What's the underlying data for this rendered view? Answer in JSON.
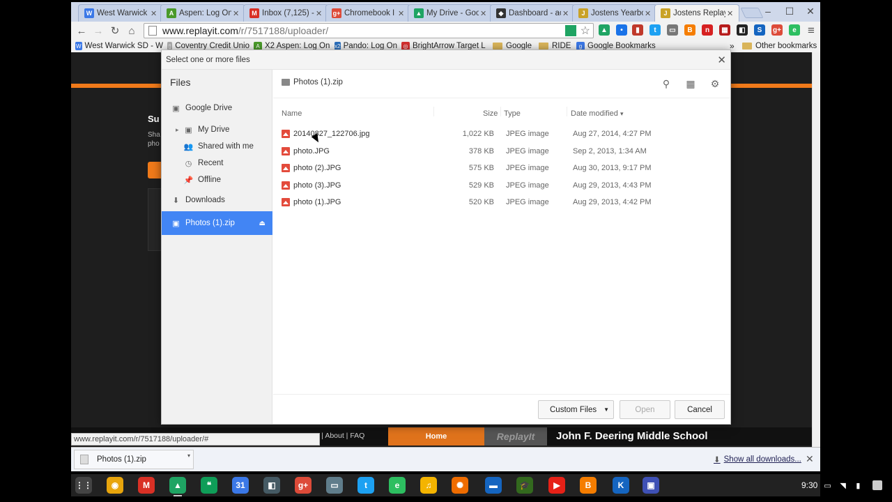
{
  "window": {
    "minimize": "–",
    "maximize": "☐",
    "close": "✕"
  },
  "tabs": [
    {
      "title": "West Warwick I",
      "favicon": "W",
      "color": "#3b78e7"
    },
    {
      "title": "Aspen: Log On",
      "favicon": "A",
      "color": "#4a9a2a"
    },
    {
      "title": "Inbox (7,125) - ",
      "favicon": "M",
      "color": "#d93025"
    },
    {
      "title": "Chromebook I",
      "favicon": "g+",
      "color": "#dd4b39"
    },
    {
      "title": "My Drive - Goo",
      "favicon": "▲",
      "color": "#1fa463"
    },
    {
      "title": "Dashboard - ac",
      "favicon": "◆",
      "color": "#333333"
    },
    {
      "title": "Jostens Yearbo",
      "favicon": "J",
      "color": "#c9a227"
    },
    {
      "title": "Jostens ReplayI",
      "favicon": "J",
      "color": "#c9a227"
    }
  ],
  "toolbar": {
    "back": "←",
    "forward": "→",
    "reload": "↻",
    "home": "⌂",
    "url_host": "www.replayit.com",
    "url_path": "/r/7517188/uploader/",
    "star": "☆",
    "menu": "≡",
    "extensions": [
      {
        "name": "drive-ext-icon",
        "label": "▲",
        "color": "#1fa463"
      },
      {
        "name": "pocket-ext-icon",
        "label": "•",
        "color": "#1a73e8"
      },
      {
        "name": "book-ext-icon",
        "label": "▮",
        "color": "#c0392b"
      },
      {
        "name": "twitter-ext-icon",
        "label": "t",
        "color": "#1da1f2"
      },
      {
        "name": "cast-ext-icon",
        "label": "▭",
        "color": "#777777"
      },
      {
        "name": "blogger-ext-icon",
        "label": "B",
        "color": "#f57d00"
      },
      {
        "name": "npr-ext-icon",
        "label": "n",
        "color": "#d62021"
      },
      {
        "name": "film-ext-icon",
        "label": "▦",
        "color": "#b71c1c"
      },
      {
        "name": "screencast-ext-icon",
        "label": "◧",
        "color": "#222222"
      },
      {
        "name": "s-ext-icon",
        "label": "S",
        "color": "#1565c0"
      },
      {
        "name": "gplus-ext-icon",
        "label": "g+",
        "color": "#dd4b39"
      },
      {
        "name": "evernote-ext-icon",
        "label": "e",
        "color": "#2dbe60"
      }
    ]
  },
  "bookmarks": [
    {
      "label": "West Warwick SD - W",
      "icon": "W",
      "color": "#3b78e7"
    },
    {
      "label": "Coventry Credit Unio",
      "icon": "▯",
      "color": "#aaaaaa"
    },
    {
      "label": "X2 Aspen: Log On",
      "icon": "A",
      "color": "#4a9a2a"
    },
    {
      "label": "Pando: Log On",
      "icon": "x2",
      "color": "#2a6ebb"
    },
    {
      "label": "BrightArrow Target L",
      "icon": "◎",
      "color": "#d32f2f"
    },
    {
      "label": "Google",
      "icon": "folder",
      "color": "#d9b45a"
    },
    {
      "label": "RIDE",
      "icon": "folder",
      "color": "#d9b45a"
    },
    {
      "label": "Google Bookmarks",
      "icon": "g",
      "color": "#3b78e7"
    }
  ],
  "bookmarks_more": "»",
  "other_bookmarks": "Other bookmarks",
  "page": {
    "fragment_heading": "Su",
    "fragment_text1": "Sha",
    "fragment_text2": "pho",
    "footer_links": "acy  |  About  |  FAQ",
    "footer_home": "Home",
    "footer_logo": "ReplayIt",
    "footer_school": "John F. Deering Middle School",
    "status_url": "www.replayit.com/r/7517188/uploader/#"
  },
  "dialog": {
    "title": "Select one or more files",
    "close": "✕",
    "nav_header": "Files",
    "nav_items": [
      {
        "label": "Google Drive",
        "icon": "▣",
        "indent": 0
      },
      {
        "label": "My Drive",
        "icon": "▣",
        "indent": 1,
        "arrow": "▸"
      },
      {
        "label": "Shared with me",
        "icon": "👥",
        "indent": 1
      },
      {
        "label": "Recent",
        "icon": "◷",
        "indent": 1
      },
      {
        "label": "Offline",
        "icon": "📌",
        "indent": 1
      },
      {
        "label": "Downloads",
        "icon": "⬇",
        "indent": 0
      },
      {
        "label": "Photos (1).zip",
        "icon": "▣",
        "indent": 0,
        "selected": true,
        "eject": "⏏"
      }
    ],
    "breadcrumb": "Photos (1).zip",
    "search_icon": "⚲",
    "grid_icon": "▦",
    "gear_icon": "⚙",
    "columns": {
      "name": "Name",
      "size": "Size",
      "type": "Type",
      "date": "Date modified",
      "sort_arrow": "▾"
    },
    "files": [
      {
        "name": "20140827_122706.jpg",
        "size": "1,022 KB",
        "type": "JPEG image",
        "date": "Aug 27, 2014, 4:27 PM"
      },
      {
        "name": "photo.JPG",
        "size": "378 KB",
        "type": "JPEG image",
        "date": "Sep 2, 2013, 1:34 AM"
      },
      {
        "name": "photo (2).JPG",
        "size": "575 KB",
        "type": "JPEG image",
        "date": "Aug 30, 2013, 9:17 PM"
      },
      {
        "name": "photo (3).JPG",
        "size": "529 KB",
        "type": "JPEG image",
        "date": "Aug 29, 2013, 4:43 PM"
      },
      {
        "name": "photo (1).JPG",
        "size": "520 KB",
        "type": "JPEG image",
        "date": "Aug 29, 2013, 4:42 PM"
      }
    ],
    "filter_label": "Custom Files",
    "filter_caret": "▼",
    "open_label": "Open",
    "cancel_label": "Cancel"
  },
  "downloads": {
    "file": "Photos (1).zip",
    "caret": "▾",
    "show_all": "Show all downloads...",
    "show_all_icon": "⬇",
    "close": "✕"
  },
  "shelf": {
    "apps": [
      {
        "name": "app-launcher-icon",
        "label": "⋮⋮",
        "color": "#444444"
      },
      {
        "name": "chrome-icon",
        "label": "◉",
        "color": "#e8a50c"
      },
      {
        "name": "gmail-icon",
        "label": "M",
        "color": "#d93025"
      },
      {
        "name": "drive-icon",
        "label": "▲",
        "color": "#1fa463",
        "running": true
      },
      {
        "name": "hangouts-icon",
        "label": "❝",
        "color": "#0f9d58"
      },
      {
        "name": "calendar-icon",
        "label": "31",
        "color": "#3b78e7"
      },
      {
        "name": "screencastify-icon",
        "label": "◧",
        "color": "#455a64"
      },
      {
        "name": "google-plus-icon",
        "label": "g+",
        "color": "#dd4b39"
      },
      {
        "name": "presentation-icon",
        "label": "▭",
        "color": "#607d8b"
      },
      {
        "name": "twitter-icon",
        "label": "t",
        "color": "#1da1f2"
      },
      {
        "name": "evernote-icon",
        "label": "e",
        "color": "#2dbe60"
      },
      {
        "name": "music-icon",
        "label": "♫",
        "color": "#f4b400"
      },
      {
        "name": "pinwheel-icon",
        "label": "✺",
        "color": "#ef6c00"
      },
      {
        "name": "files-icon",
        "label": "▬",
        "color": "#1565c0"
      },
      {
        "name": "classroom-icon",
        "label": "🎓",
        "color": "#33691e"
      },
      {
        "name": "youtube-icon",
        "label": "▶",
        "color": "#e62117"
      },
      {
        "name": "blogger-icon",
        "label": "B",
        "color": "#f57d00"
      },
      {
        "name": "k-app-icon",
        "label": "K",
        "color": "#1565c0"
      },
      {
        "name": "window-app-icon",
        "label": "▣",
        "color": "#3f51b5"
      }
    ],
    "clock": "9:30",
    "tray_icons": [
      "▭",
      "◥",
      "▮"
    ]
  }
}
